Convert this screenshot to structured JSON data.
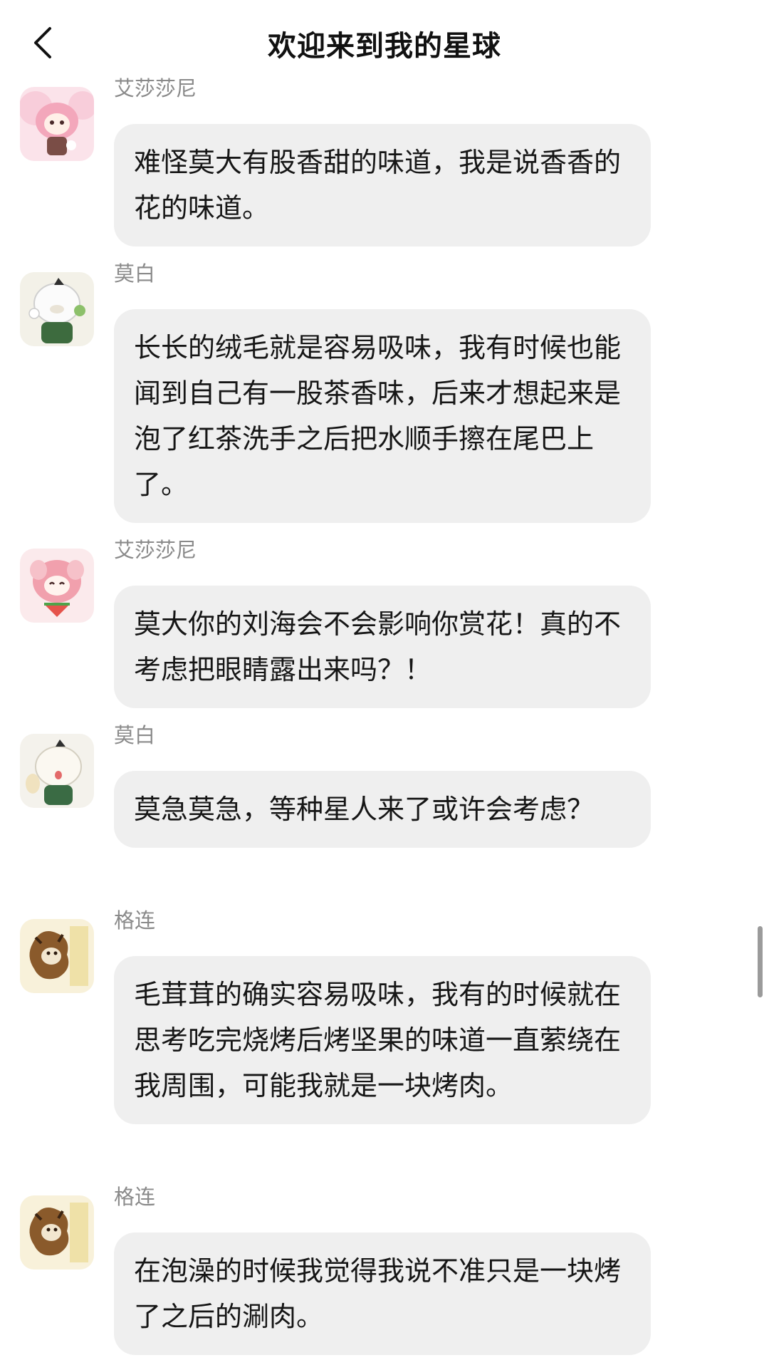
{
  "header": {
    "title": "欢迎来到我的星球"
  },
  "messages": [
    {
      "sender": "艾莎莎尼",
      "text": "难怪莫大有股香甜的味道，我是说香香的花的味道。"
    },
    {
      "sender": "莫白",
      "text": "长长的绒毛就是容易吸味，我有时候也能闻到自己有一股茶香味，后来才想起来是泡了红茶洗手之后把水顺手擦在尾巴上了。"
    },
    {
      "sender": "艾莎莎尼",
      "text": "莫大你的刘海会不会影响你赏花！真的不考虑把眼睛露出来吗？！"
    },
    {
      "sender": "莫白",
      "text": "莫急莫急，等种星人来了或许会考虑？"
    },
    {
      "sender": "格连",
      "text": "毛茸茸的确实容易吸味，我有的时候就在思考吃完烧烤后烤坚果的味道一直萦绕在我周围，可能我就是一块烤肉。"
    },
    {
      "sender": "格连",
      "text": "在泡澡的时候我觉得我说不准只是一块烤了之后的涮肉。"
    }
  ]
}
